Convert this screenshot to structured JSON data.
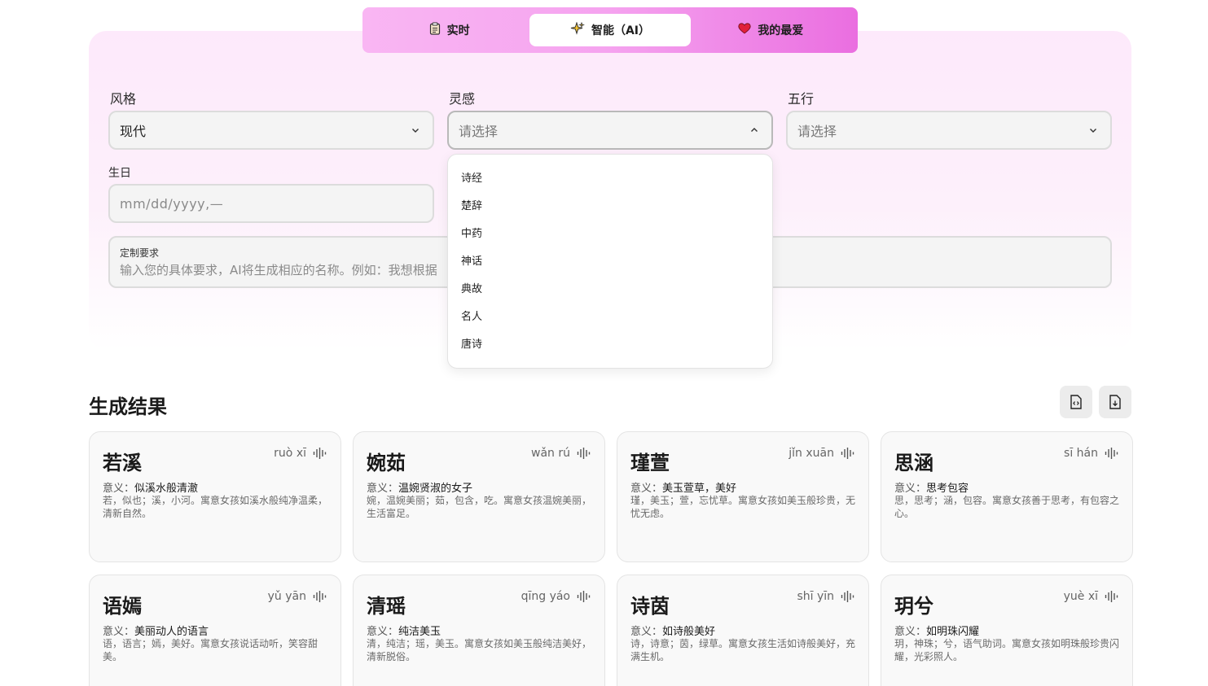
{
  "tabs": [
    {
      "icon": "clipboard-icon",
      "label": "实时",
      "active": false
    },
    {
      "icon": "sparkles-icon",
      "label": "智能（AI）",
      "active": true
    },
    {
      "icon": "heart-icon",
      "label": "我的最爱",
      "active": false
    }
  ],
  "form": {
    "style_label": "风格",
    "style_value": "现代",
    "inspiration_label": "灵感",
    "inspiration_placeholder": "请选择",
    "wuxing_label": "五行",
    "wuxing_placeholder": "请选择",
    "birthday_label": "生日",
    "birthday_placeholder": "mm/dd/yyyy,—",
    "custom_label": "定制要求",
    "custom_placeholder": "输入您的具体要求，AI将生成相应的名称。例如：我想根据",
    "inspiration_options": [
      "诗经",
      "楚辞",
      "中药",
      "神话",
      "典故",
      "名人",
      "唐诗"
    ]
  },
  "results": {
    "title": "生成结果",
    "meaning_prefix": "意义：",
    "cards": [
      {
        "name": "若溪",
        "pinyin": "ruò xī",
        "meaning": "似溪水般清澈",
        "desc": "若，似也；溪，小河。寓意女孩如溪水般纯净温柔，清新自然。"
      },
      {
        "name": "婉茹",
        "pinyin": "wǎn rú",
        "meaning": "温婉贤淑的女子",
        "desc": "婉，温婉美丽；茹，包含，吃。寓意女孩温婉美丽，生活富足。"
      },
      {
        "name": "瑾萱",
        "pinyin": "jǐn xuān",
        "meaning": "美玉萱草，美好",
        "desc": "瑾，美玉；萱，忘忧草。寓意女孩如美玉般珍贵，无忧无虑。"
      },
      {
        "name": "思涵",
        "pinyin": "sī hán",
        "meaning": "思考包容",
        "desc": "思，思考；涵，包容。寓意女孩善于思考，有包容之心。"
      },
      {
        "name": "语嫣",
        "pinyin": "yǔ yān",
        "meaning": "美丽动人的语言",
        "desc": "语，语言；嫣，美好。寓意女孩说话动听，笑容甜美。"
      },
      {
        "name": "清瑶",
        "pinyin": "qīng yáo",
        "meaning": "纯洁美玉",
        "desc": "清，纯洁；瑶，美玉。寓意女孩如美玉般纯洁美好，清新脱俗。"
      },
      {
        "name": "诗茵",
        "pinyin": "shī yīn",
        "meaning": "如诗般美好",
        "desc": "诗，诗意；茵，绿草。寓意女孩生活如诗般美好，充满生机。"
      },
      {
        "name": "玥兮",
        "pinyin": "yuè xī",
        "meaning": "如明珠闪耀",
        "desc": "玥，神珠；兮，语气助词。寓意女孩如明珠般珍贵闪耀，光彩照人。"
      }
    ]
  },
  "colors": {
    "tabbar_start": "#f9b6f3",
    "tabbar_end": "#ea6ee0",
    "panel_bg": "#fde9fb",
    "heart": "#e0203a"
  }
}
